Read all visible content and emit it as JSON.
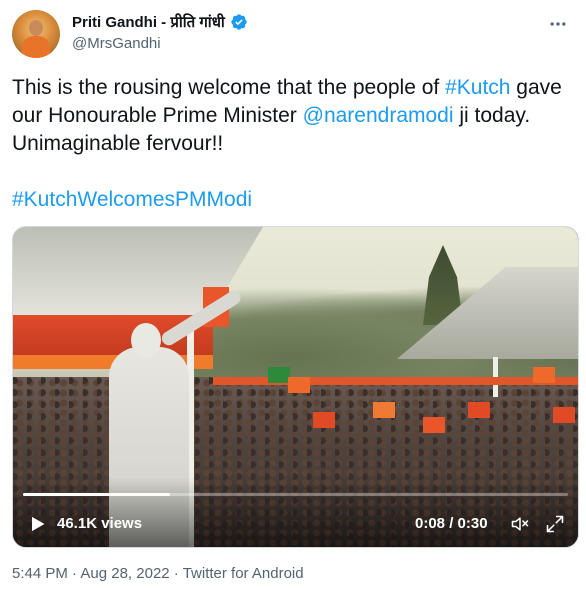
{
  "author": {
    "display_name": "Priti Gandhi - प्रीति गांधी",
    "handle": "@MrsGandhi",
    "verified": true
  },
  "tweet": {
    "line1_prefix": "This is the rousing welcome that the people of ",
    "hashtag_kutch": "#Kutch",
    "line2_prefix": " gave our Honourable Prime Minister ",
    "mention": "@narendramodi",
    "line2_suffix": " ji today. Unimaginable fervour!!",
    "hashtag_main": "#KutchWelcomesPMModi"
  },
  "video": {
    "views": "46.1K views",
    "time": "0:08 / 0:30",
    "progress_fraction": 0.27
  },
  "meta": {
    "time": "5:44 PM",
    "sep1": " · ",
    "date": "Aug 28, 2022",
    "sep2": " · ",
    "source": "Twitter for Android"
  },
  "icons": {
    "more": "more-icon",
    "verified": "verified-badge-icon",
    "play": "play-icon",
    "volume": "volume-icon",
    "fullscreen": "fullscreen-icon"
  },
  "colors": {
    "link": "#1d9bf0",
    "secondary_text": "#536471",
    "primary_text": "#0f1419"
  }
}
